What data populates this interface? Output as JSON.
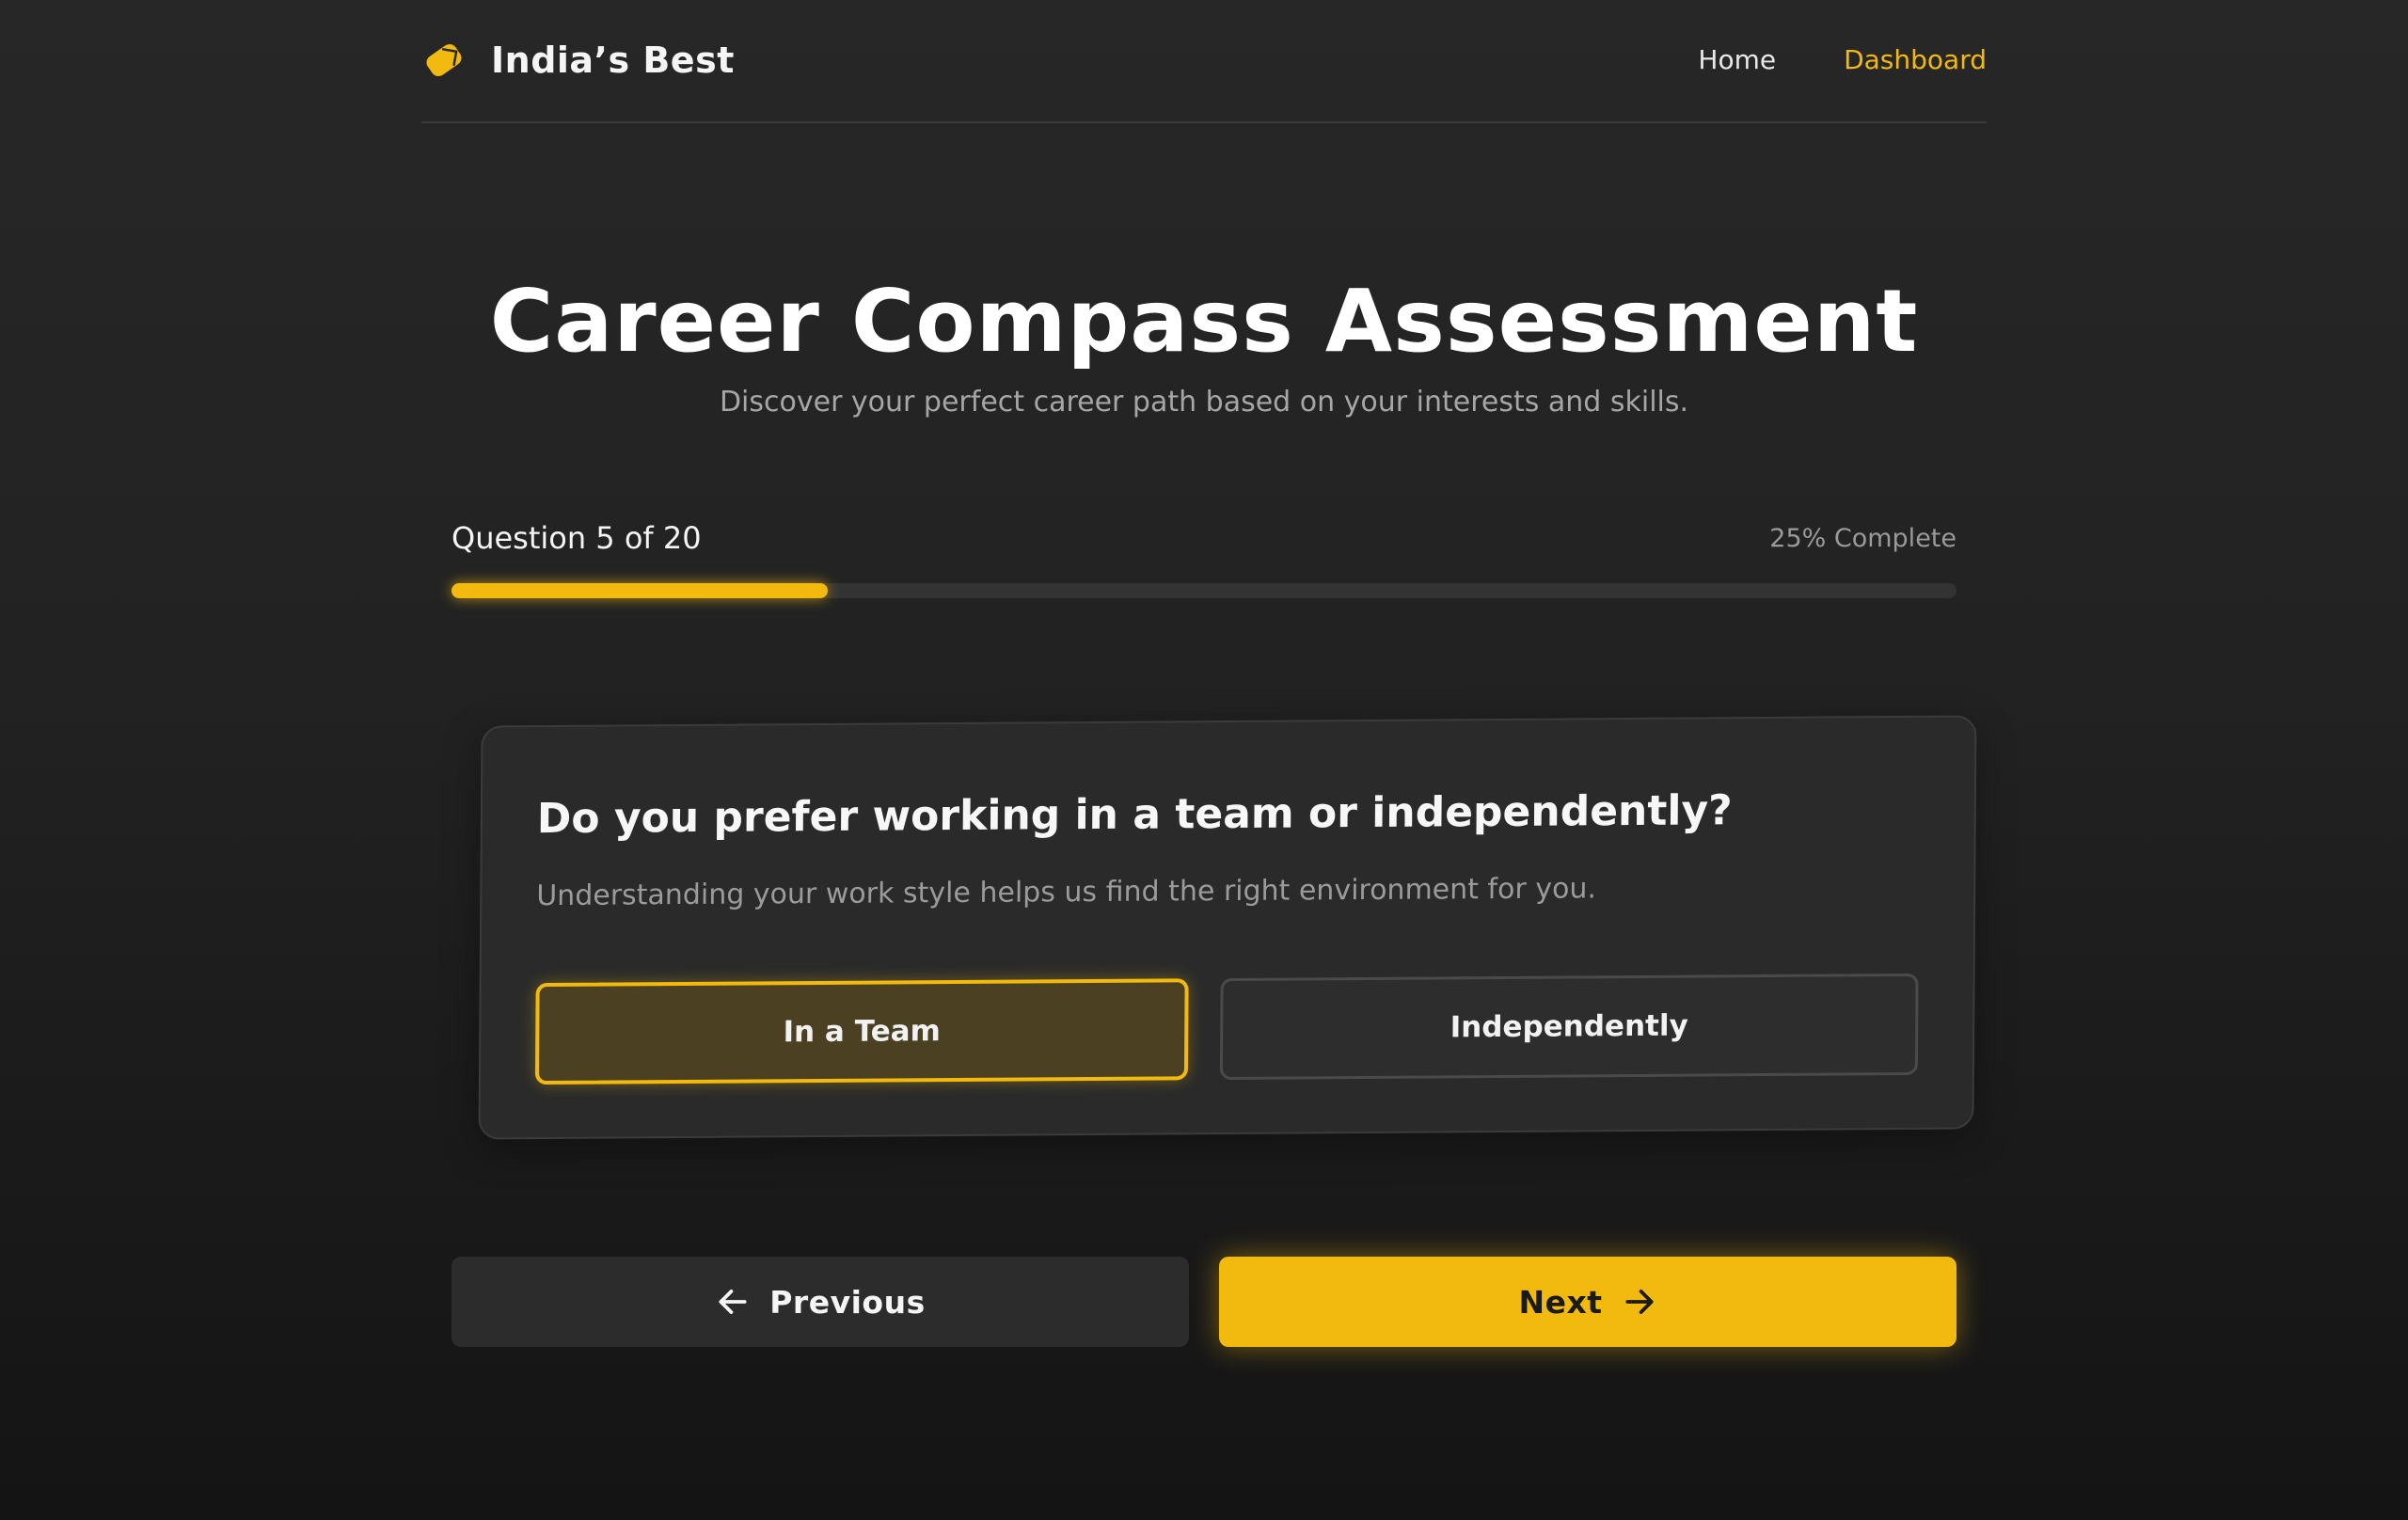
{
  "header": {
    "brand": "India’s Best",
    "logo_icon": "yellow-tag-icon",
    "nav": {
      "home": "Home",
      "dashboard": "Dashboard"
    }
  },
  "hero": {
    "title": "Career Compass Assessment",
    "subtitle": "Discover your perfect career path based on your interests and skills."
  },
  "progress": {
    "question_label": "Question 5 of 20",
    "complete_label": "25% Complete",
    "fraction": 0.25
  },
  "card": {
    "question": "Do you prefer working in a team or independently?",
    "hint": "Understanding your work style helps us find the right environment for you.",
    "options": [
      {
        "label": "In a Team",
        "selected": true
      },
      {
        "label": "Independently",
        "selected": false
      }
    ]
  },
  "actions": {
    "previous": "Previous",
    "next": "Next",
    "previous_icon": "arrow-left-icon",
    "next_icon": "arrow-right-icon"
  },
  "colors": {
    "accent": "#f2b90f",
    "background": "#222222",
    "card": "#2a2a2a"
  }
}
